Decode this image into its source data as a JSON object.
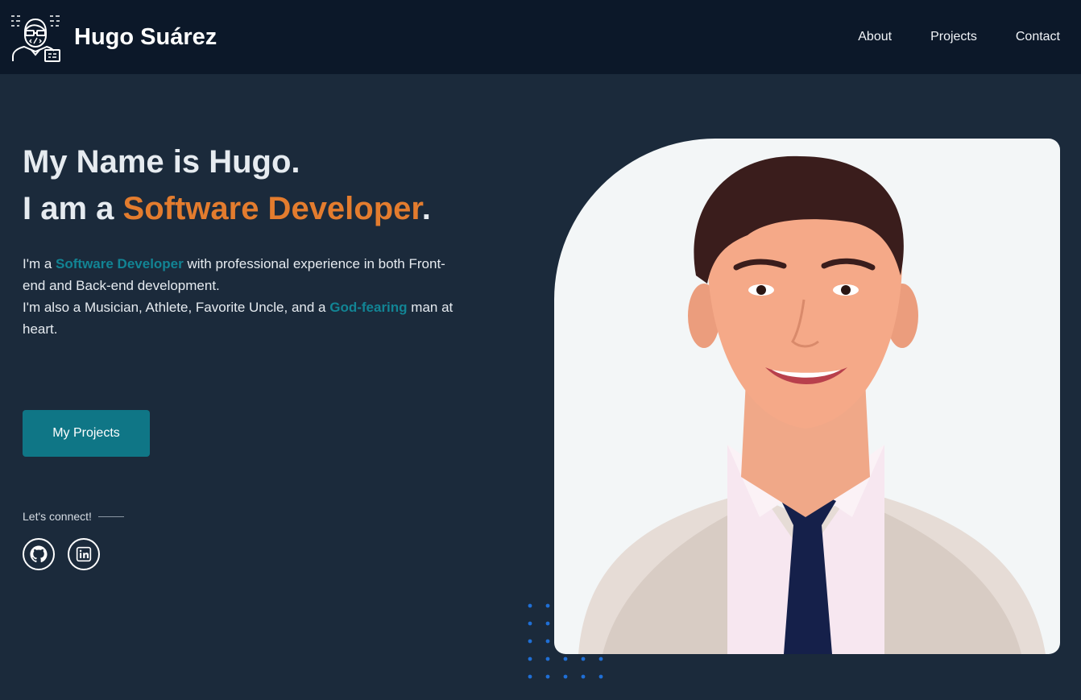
{
  "nav": {
    "brand": "Hugo Suárez",
    "links": [
      "About",
      "Projects",
      "Contact"
    ]
  },
  "hero": {
    "line1": "My Name is Hugo.",
    "line2_prefix": "I am a ",
    "line2_highlight": "Software Developer",
    "line2_suffix": ".",
    "bio": {
      "p1_prefix": "I'm a ",
      "p1_highlight": "Software Developer",
      "p1_suffix": " with professional experience in both Front-end and Back-end development.",
      "p2_prefix": "I'm also a Musician, Athlete, Favorite Uncle, and a ",
      "p2_highlight": "God-fearing",
      "p2_suffix": " man at heart."
    },
    "cta_label": "My Projects"
  },
  "connect": {
    "label": "Let's connect!",
    "socials": [
      "github-icon",
      "linkedin-icon"
    ]
  },
  "colors": {
    "navbar_bg": "#0c1829",
    "page_bg": "#1b2a3b",
    "accent_orange": "#e37c2e",
    "accent_teal": "#128494",
    "button_bg": "#0f7686",
    "dots": "#1f6fd6"
  }
}
